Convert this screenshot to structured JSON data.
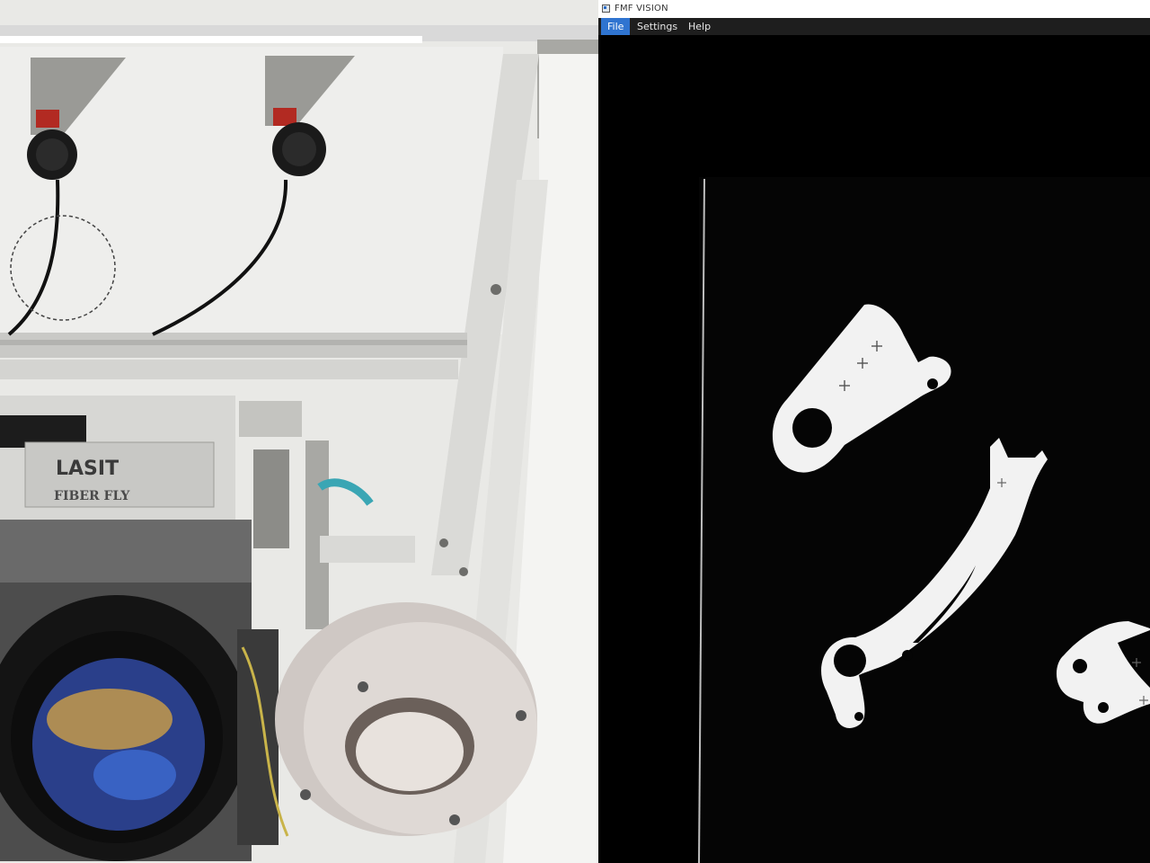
{
  "window": {
    "title": "FMF VISION"
  },
  "menu": [
    {
      "label": "File",
      "active": true
    },
    {
      "label": "Settings",
      "active": false
    },
    {
      "label": "Help",
      "active": false
    }
  ],
  "photo": {
    "brand_text": "LASIT",
    "model_text": "FIBER FLY"
  },
  "colors": {
    "menu_active": "#2f74d0",
    "menubar_bg": "#1e1e1e",
    "viewport_bg": "#000000",
    "part_fill": "#f2f2f2"
  }
}
